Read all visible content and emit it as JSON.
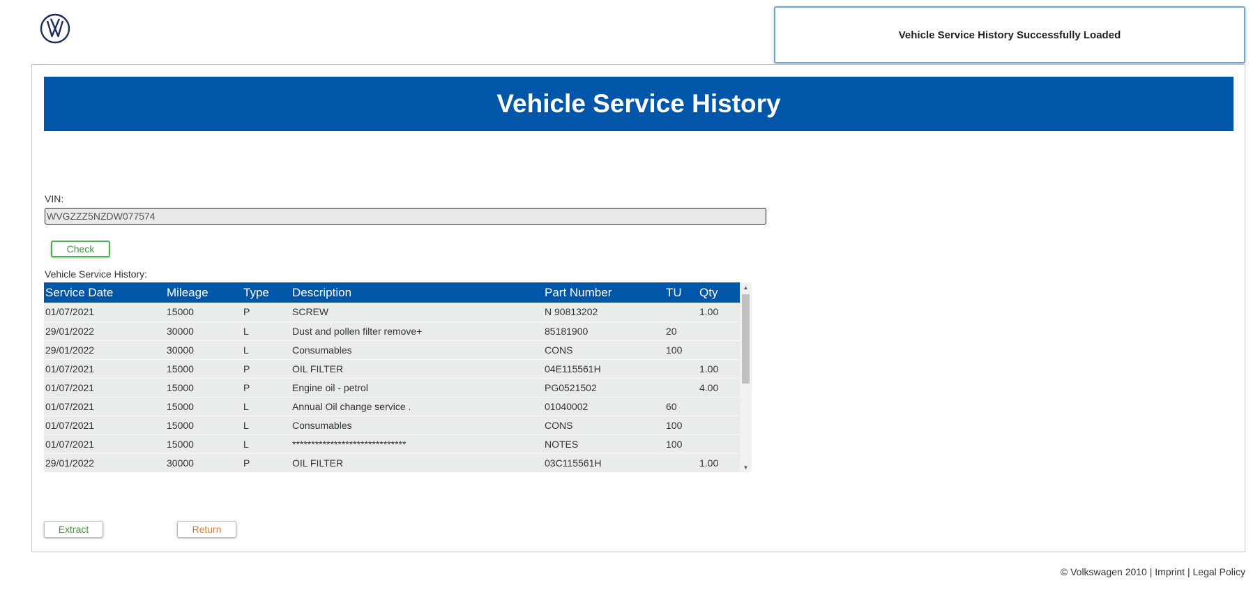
{
  "notification": {
    "message": "Vehicle Service History Successfully Loaded"
  },
  "banner": {
    "title": "Vehicle Service History"
  },
  "vin": {
    "label": "VIN:",
    "value": "WVGZZZ5NZDW077574"
  },
  "buttons": {
    "check": "Check",
    "extract": "Extract",
    "return": "Return"
  },
  "history": {
    "label": "Vehicle Service History:",
    "columns": [
      "Service Date",
      "Mileage",
      "Type",
      "Description",
      "Part Number",
      "TU",
      "Qty"
    ],
    "rows": [
      [
        "01/07/2021",
        "15000",
        "P",
        "SCREW",
        "N 90813202",
        "",
        "1.00"
      ],
      [
        "29/01/2022",
        "30000",
        "L",
        "Dust and pollen filter remove+",
        "85181900",
        "20",
        ""
      ],
      [
        "29/01/2022",
        "30000",
        "L",
        "Consumables",
        "CONS",
        "100",
        ""
      ],
      [
        "01/07/2021",
        "15000",
        "P",
        "OIL FILTER",
        "04E115561H",
        "",
        "1.00"
      ],
      [
        "01/07/2021",
        "15000",
        "P",
        "Engine oil - petrol",
        "PG0521502",
        "",
        "4.00"
      ],
      [
        "01/07/2021",
        "15000",
        "L",
        "Annual Oil change service .",
        "01040002",
        "60",
        ""
      ],
      [
        "01/07/2021",
        "15000",
        "L",
        "Consumables",
        "CONS",
        "100",
        ""
      ],
      [
        "01/07/2021",
        "15000",
        "L",
        "******************************",
        "NOTES",
        "100",
        ""
      ],
      [
        "29/01/2022",
        "30000",
        "P",
        "OIL FILTER",
        "03C115561H",
        "",
        "1.00"
      ]
    ]
  },
  "footer": {
    "copyright": "© Volkswagen 2010",
    "sep1": " | ",
    "imprint": "Imprint",
    "sep2": " | ",
    "legal": "Legal Policy"
  },
  "colors": {
    "brand_blue": "#0056a8",
    "check_green": "#3a9a3a",
    "return_orange": "#e57a2b"
  },
  "icons": {
    "logo": "vw-logo-icon"
  }
}
